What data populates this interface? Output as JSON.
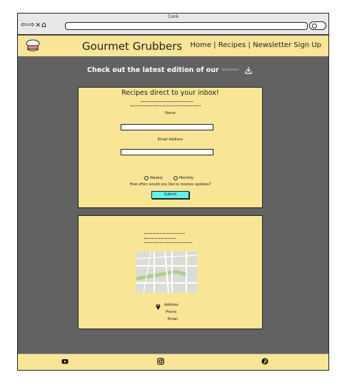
{
  "window": {
    "title": "Conk"
  },
  "brand": {
    "name": "Gourmet Grubbers"
  },
  "nav": {
    "home": "Home",
    "sep1": " | ",
    "recipes": "Recipes",
    "sep2": " | ",
    "newsletter": "Newsletter Sign Up"
  },
  "promo": {
    "text": "Check out the latest edition of our",
    "tag": "Newsletter"
  },
  "form": {
    "title": "Recipes direct to your inbox!",
    "name_label": "Name",
    "email_label": "Email Address",
    "radio_weekly": "Weekly",
    "radio_monthly": "Monthly",
    "frequency_question": "How often would you like to receive updates?",
    "submit_label": "Submit"
  },
  "contact": {
    "address_label": "Address",
    "phone_label": "Phone",
    "email_label": "Email"
  },
  "icons": [
    "chef-hat-icon",
    "download-icon",
    "map-pin-icon",
    "youtube-icon",
    "instagram-icon",
    "pinterest-icon"
  ],
  "colors": {
    "accent": "#f8e596",
    "background": "#626262",
    "submit": "#5ef2ee"
  }
}
